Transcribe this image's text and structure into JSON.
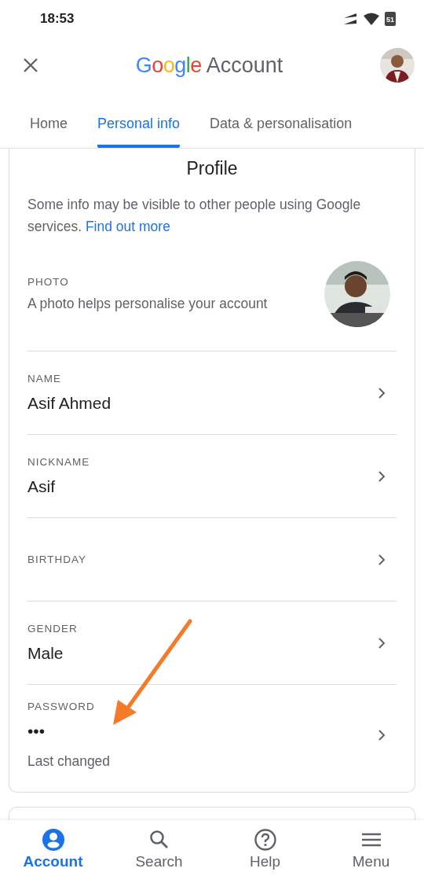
{
  "status_bar": {
    "time": "18:53",
    "battery": "51"
  },
  "header": {
    "brand": "Google",
    "title": "Account"
  },
  "tabs": [
    {
      "label": "Home",
      "selected": false
    },
    {
      "label": "Personal info",
      "selected": true
    },
    {
      "label": "Data & personalisation",
      "selected": false
    }
  ],
  "profile": {
    "title": "Profile",
    "intro": "Some info may be visible to other people using Google services.",
    "link": "Find out more",
    "photo": {
      "label": "PHOTO",
      "text": "A photo helps personalise your account"
    },
    "rows": [
      {
        "label": "NAME",
        "value": "Asif Ahmed"
      },
      {
        "label": "NICKNAME",
        "value": "Asif"
      },
      {
        "label": "BIRTHDAY"
      },
      {
        "label": "GENDER",
        "value": "Male"
      },
      {
        "label": "PASSWORD",
        "value": "•••",
        "note": "Last changed"
      }
    ]
  },
  "bottom_nav": [
    {
      "label": "Account",
      "kind": "account",
      "selected": true
    },
    {
      "label": "Search",
      "kind": "search",
      "selected": false
    },
    {
      "label": "Help",
      "kind": "help",
      "selected": false
    },
    {
      "label": "Menu",
      "kind": "menu",
      "selected": false
    }
  ]
}
